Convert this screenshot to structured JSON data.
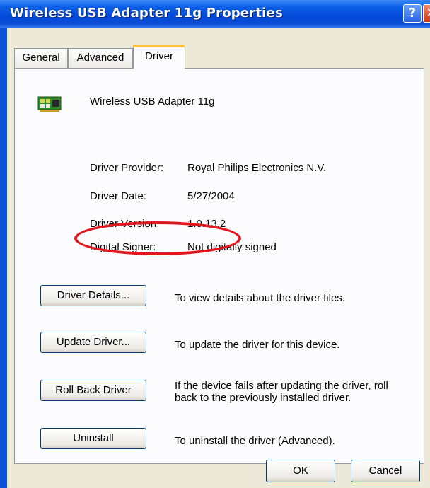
{
  "window": {
    "title": "Wireless USB Adapter 11g Properties",
    "help_glyph": "?",
    "close_glyph": "✕"
  },
  "tabs": [
    {
      "label": "General",
      "active": false
    },
    {
      "label": "Advanced",
      "active": false
    },
    {
      "label": "Driver",
      "active": true
    }
  ],
  "device": {
    "name": "Wireless USB Adapter 11g",
    "icon": "network-adapter-icon"
  },
  "driver_info": [
    {
      "label": "Driver Provider:",
      "value": "Royal Philips Electronics N.V."
    },
    {
      "label": "Driver Date:",
      "value": "5/27/2004"
    },
    {
      "label": "Driver Version:",
      "value": "1.0.13.2"
    },
    {
      "label": "Digital Signer:",
      "value": "Not digitally signed"
    }
  ],
  "actions": [
    {
      "button": "Driver Details...",
      "description": "To view details about the driver files."
    },
    {
      "button": "Update Driver...",
      "description": "To update the driver for this device."
    },
    {
      "button": "Roll Back Driver",
      "description_line1": "If the device fails after updating the driver, roll",
      "description_line2": "back to the previously installed driver."
    },
    {
      "button": "Uninstall",
      "description": "To uninstall the driver (Advanced)."
    }
  ],
  "footer": {
    "ok": "OK",
    "cancel": "Cancel"
  },
  "colors": {
    "titlebar": "#0a4fd3",
    "dialog_bg": "#ece9d8",
    "highlight_ellipse": "#e0181e",
    "active_tab_accent": "#ffc83c"
  }
}
